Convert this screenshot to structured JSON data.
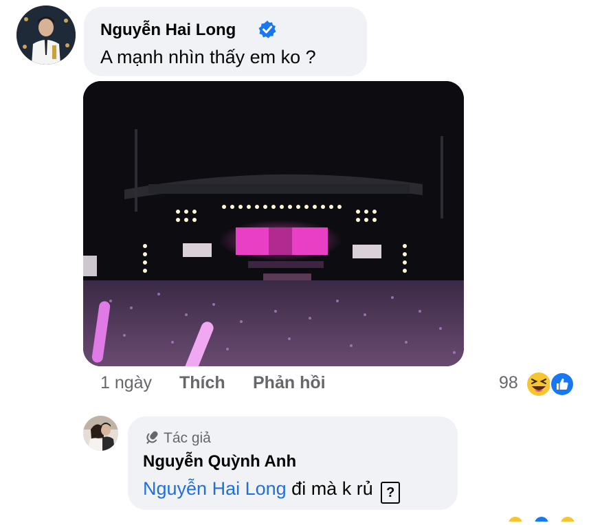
{
  "comment": {
    "author": "Nguyễn Hai Long",
    "verified_icon": "verified-badge-icon",
    "text": "A mạnh nhìn thấy em ko ?",
    "photo_icon": "concert-stage-photo",
    "time": "1 ngày",
    "like_label": "Thích",
    "reply_label": "Phản hồi",
    "reaction_count": "98",
    "reactions": [
      "haha-icon",
      "like-icon"
    ]
  },
  "reply": {
    "role_icon": "microphone-icon",
    "role_label": "Tác giả",
    "author": "Nguyễn Quỳnh Anh",
    "mention": "Nguyễn Hai Long",
    "text": "đi mà k rủ",
    "trailing_glyph": "?"
  },
  "colors": {
    "bubble": "#f0f2f5",
    "mention": "#216fdb",
    "meta": "#65676b",
    "verified": "#1877f2"
  }
}
